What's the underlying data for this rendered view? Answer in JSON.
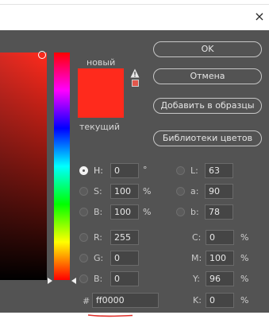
{
  "window": {
    "close_glyph": "×"
  },
  "labels": {
    "new": "новый",
    "current": "текущий"
  },
  "swatches": {
    "new_color": "#ff2a1c",
    "current_color": "#ff2a1c"
  },
  "buttons": {
    "ok": "OK",
    "cancel": "Отмена",
    "add_to_swatches": "Добавить в образцы",
    "color_libraries": "Библиотеки цветов"
  },
  "fields": {
    "h": {
      "label": "H:",
      "value": "0",
      "unit": "°"
    },
    "s": {
      "label": "S:",
      "value": "100",
      "unit": "%"
    },
    "b": {
      "label": "B:",
      "value": "100",
      "unit": "%"
    },
    "r": {
      "label": "R:",
      "value": "255"
    },
    "g": {
      "label": "G:",
      "value": "0"
    },
    "bl": {
      "label": "B:",
      "value": "0"
    },
    "l": {
      "label": "L:",
      "value": "63"
    },
    "a": {
      "label": "a:",
      "value": "90"
    },
    "lab_b": {
      "label": "b:",
      "value": "78"
    },
    "c": {
      "label": "C:",
      "value": "0",
      "unit": "%"
    },
    "m": {
      "label": "M:",
      "value": "100",
      "unit": "%"
    },
    "y": {
      "label": "Y:",
      "value": "96",
      "unit": "%"
    },
    "k": {
      "label": "K:",
      "value": "0",
      "unit": "%"
    },
    "hex": {
      "label": "#",
      "value": "ff0000"
    }
  },
  "icons": {
    "warning": "warning-triangle-icon",
    "gamut": "gamut-swatch-icon"
  },
  "colors": {
    "dialog_bg": "#535353",
    "accent_red": "#ff2a1c"
  }
}
